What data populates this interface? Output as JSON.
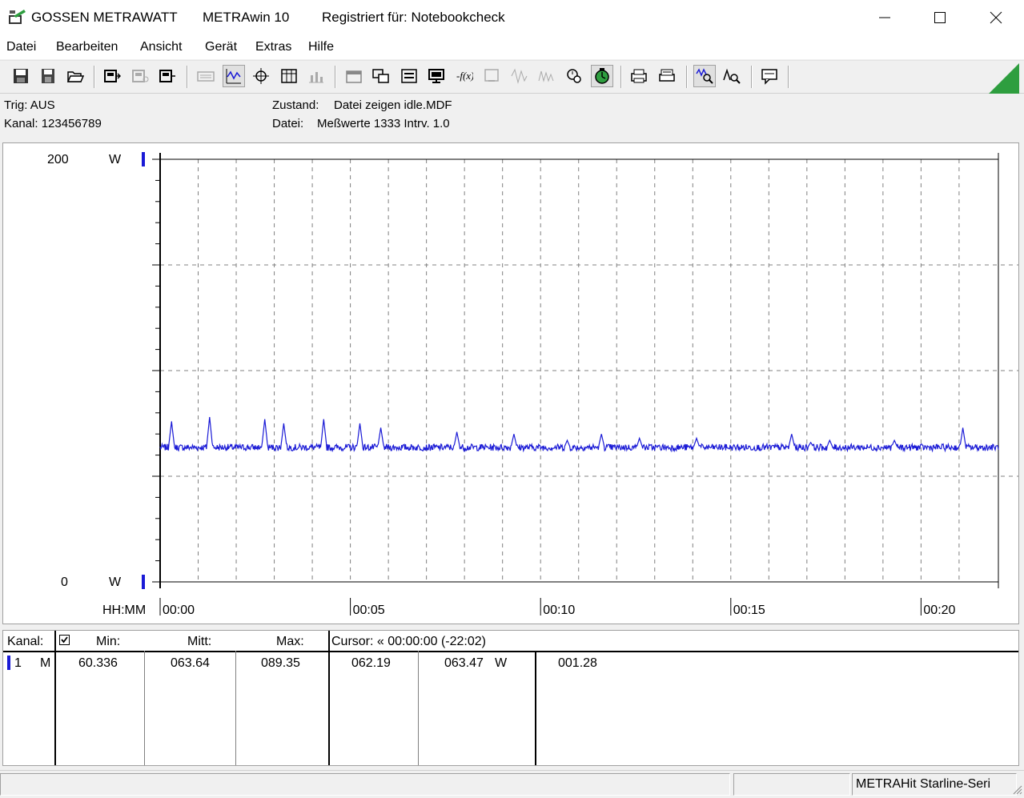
{
  "window": {
    "title_parts": [
      "GOSSEN METRAWATT",
      "METRAwin 10",
      "Registriert für: Notebookcheck"
    ]
  },
  "menu": [
    "Datei",
    "Bearbeiten",
    "Ansicht",
    "Gerät",
    "Extras",
    "Hilfe"
  ],
  "info": {
    "trig": "Trig: AUS",
    "kanal": "Kanal: 123456789",
    "zustand_label": "Zustand:",
    "zustand_value": "Datei zeigen idle.MDF",
    "datei_label": "Datei:",
    "datei_value": "Meßwerte 1333   Intrv. 1.0"
  },
  "chart": {
    "y_top_value": "200",
    "y_top_unit": "W",
    "y_bottom_value": "0",
    "y_bottom_unit": "W",
    "x_axis_label": "HH:MM",
    "x_ticks": [
      "00:00",
      "00:05",
      "00:10",
      "00:15",
      "00:20"
    ],
    "series_color": "#1a1ad6"
  },
  "chart_data": {
    "type": "line",
    "xlabel": "HH:MM",
    "ylabel": "W",
    "ylim": [
      0,
      200
    ],
    "xlim_minutes": [
      0,
      22.033
    ],
    "x_tick_labels": [
      "00:00",
      "00:05",
      "00:10",
      "00:15",
      "00:20"
    ],
    "grid": true,
    "series": [
      {
        "name": "1",
        "baseline": 63.64,
        "min": 60.336,
        "max": 89.35,
        "spikes_minute_value": [
          [
            0.3,
            76
          ],
          [
            1.3,
            78
          ],
          [
            2.75,
            77
          ],
          [
            3.25,
            75
          ],
          [
            4.3,
            77
          ],
          [
            5.25,
            75
          ],
          [
            5.8,
            73
          ],
          [
            7.8,
            71
          ],
          [
            9.3,
            70
          ],
          [
            10.7,
            67
          ],
          [
            11.6,
            70
          ],
          [
            12.6,
            68
          ],
          [
            14.1,
            68
          ],
          [
            16.6,
            70
          ],
          [
            17.1,
            66
          ],
          [
            17.6,
            67
          ],
          [
            19.3,
            67
          ],
          [
            21.1,
            73
          ]
        ]
      }
    ]
  },
  "table": {
    "headers": {
      "kanal": "Kanal:",
      "min": "Min:",
      "mitt": "Mitt:",
      "max": "Max:",
      "cursor": "Cursor: « 00:00:00 (-22:02)"
    },
    "rows": [
      {
        "channel": "1",
        "mode": "M",
        "min": "60.336",
        "mitt": "063.64",
        "max": "089.35",
        "cursor_value": "062.19",
        "cursor_value2": "063.47",
        "unit": "W",
        "extra": "001.28"
      }
    ]
  },
  "status": {
    "device": "METRAHit Starline-Seri"
  }
}
